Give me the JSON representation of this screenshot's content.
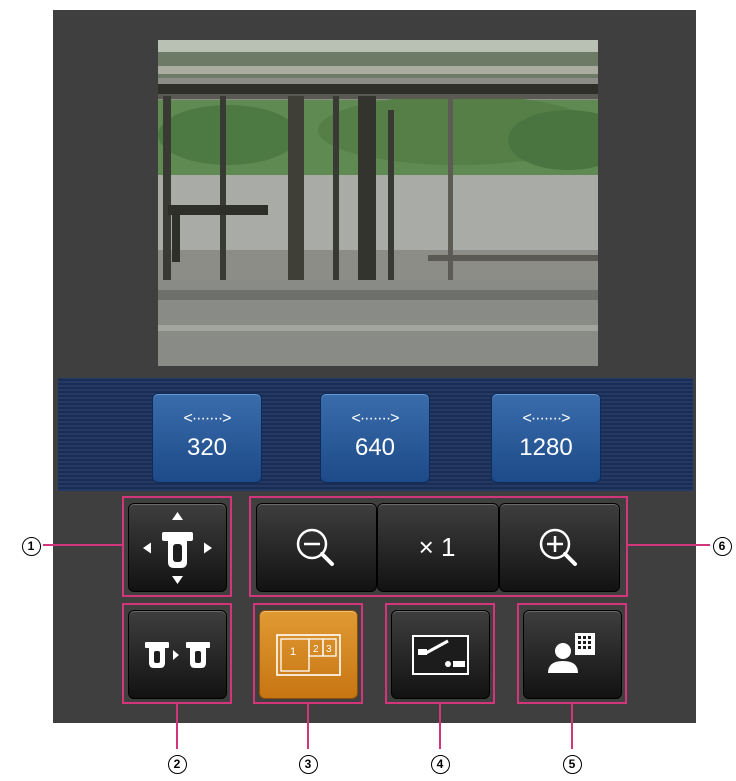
{
  "resolution_buttons": [
    {
      "arrow": "<·······>",
      "label": "320"
    },
    {
      "arrow": "<·······>",
      "label": "640"
    },
    {
      "arrow": "<·······>",
      "label": "1280"
    }
  ],
  "zoom": {
    "label": "× 1"
  },
  "callouts": [
    "1",
    "2",
    "3",
    "4",
    "5",
    "6"
  ],
  "icons": {
    "pan_tilt": "pan-tilt-control-icon",
    "zoom_out": "zoom-out-icon",
    "zoom_in": "zoom-in-icon",
    "camera_switch": "camera-switch-icon",
    "multi_screen": "multi-screen-icon",
    "alarm_out": "alarm-output-icon",
    "user_manage": "user-info-icon"
  },
  "colors": {
    "accent": "#d2357a",
    "active_button": "#d5871f",
    "resolution_button": "#2a5c9c",
    "panel_background": "#3f3f3f"
  }
}
